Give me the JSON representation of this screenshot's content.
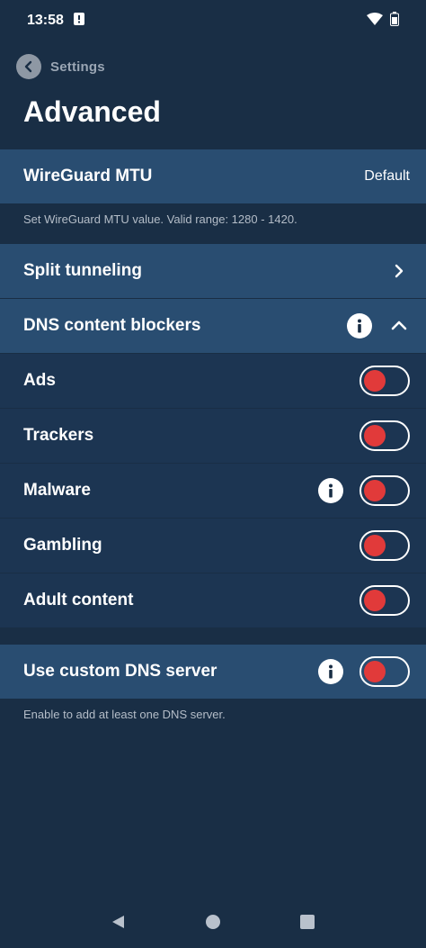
{
  "status": {
    "time": "13:58"
  },
  "header": {
    "back_label": "Settings",
    "title": "Advanced"
  },
  "mtu": {
    "label": "WireGuard MTU",
    "value": "Default",
    "footer": "Set WireGuard MTU value. Valid range: 1280 - 1420."
  },
  "split_tunneling": {
    "label": "Split tunneling"
  },
  "dns_blockers": {
    "label": "DNS content blockers",
    "items": [
      {
        "label": "Ads",
        "enabled": false
      },
      {
        "label": "Trackers",
        "enabled": false
      },
      {
        "label": "Malware",
        "enabled": false
      },
      {
        "label": "Gambling",
        "enabled": false
      },
      {
        "label": "Adult content",
        "enabled": false
      }
    ]
  },
  "custom_dns": {
    "label": "Use custom DNS server",
    "enabled": false,
    "footer": "Enable to add at least one DNS server."
  },
  "colors": {
    "background": "#192e45",
    "section": "#294d71",
    "item": "#1c3552",
    "toggle_off_knob": "#e13a3a"
  }
}
